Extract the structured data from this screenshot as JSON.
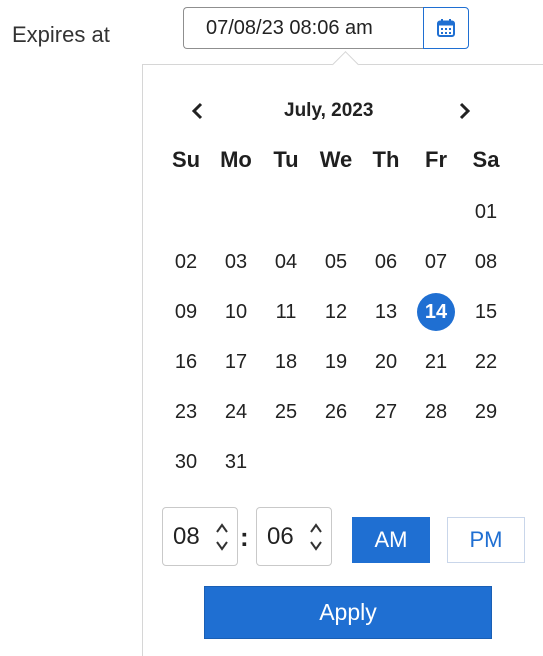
{
  "field": {
    "label": "Expires at",
    "value": "07/08/23 08:06 am",
    "button_icon": "calendar-icon"
  },
  "calendar": {
    "month_label": "July, 2023",
    "prev_icon": "chevron-left-icon",
    "next_icon": "chevron-right-icon",
    "weekdays": [
      "Su",
      "Mo",
      "Tu",
      "We",
      "Th",
      "Fr",
      "Sa"
    ],
    "weeks": [
      [
        "",
        "",
        "",
        "",
        "",
        "",
        "01"
      ],
      [
        "02",
        "03",
        "04",
        "05",
        "06",
        "07",
        "08"
      ],
      [
        "09",
        "10",
        "11",
        "12",
        "13",
        "14",
        "15"
      ],
      [
        "16",
        "17",
        "18",
        "19",
        "20",
        "21",
        "22"
      ],
      [
        "23",
        "24",
        "25",
        "26",
        "27",
        "28",
        "29"
      ],
      [
        "30",
        "31",
        "",
        "",
        "",
        "",
        ""
      ]
    ],
    "selected_day": "14"
  },
  "time": {
    "hour": "08",
    "minute": "06",
    "separator": ":",
    "am_label": "AM",
    "pm_label": "PM",
    "selected_period": "AM"
  },
  "apply_label": "Apply",
  "colors": {
    "accent": "#1f6fd2"
  }
}
